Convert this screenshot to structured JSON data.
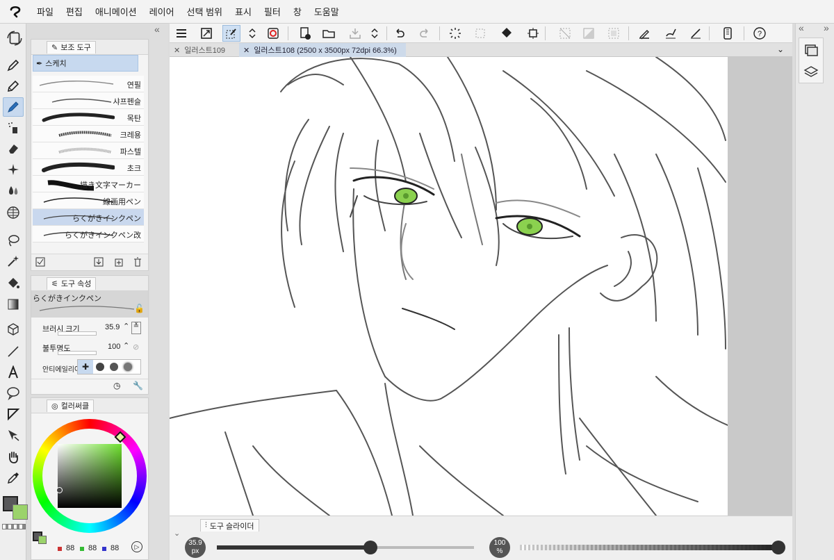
{
  "menu": [
    "파일",
    "편집",
    "애니메이션",
    "레이어",
    "선택 범위",
    "표시",
    "필터",
    "창",
    "도움말"
  ],
  "tabs": [
    {
      "label": "일러스트109",
      "active": false
    },
    {
      "label": "일러스트108 (2500 x 3500px 72dpi 66.3%)",
      "active": true
    }
  ],
  "subtool": {
    "title": "보조 도구",
    "group": "스케치",
    "brushes": [
      "연필",
      "샤프펜슬",
      "목탄",
      "크레용",
      "파스텔",
      "초크",
      "描き文字マーカー",
      "線画用ペン",
      "らくがきインクペン",
      "らくがきインクペン改"
    ]
  },
  "toolprop": {
    "title": "도구 속성",
    "preset": "らくがきインクペン",
    "brush_size_label": "브러시 크기",
    "brush_size": "35.9",
    "opacity_label": "불투명도",
    "opacity": "100",
    "aa_label": "안티에일리어스"
  },
  "colorpanel": {
    "title": "컬러써클",
    "r": "88",
    "g": "88",
    "b": "88"
  },
  "slider": {
    "title": "도구 슬라이더",
    "size_value": "35.9",
    "size_unit": "px",
    "opacity_value": "100",
    "opacity_unit": "%"
  },
  "colors": {
    "main": "#58585a",
    "sub": "#9bd36b",
    "accent": "#c7d9ef",
    "eye": "#8bd14f"
  }
}
